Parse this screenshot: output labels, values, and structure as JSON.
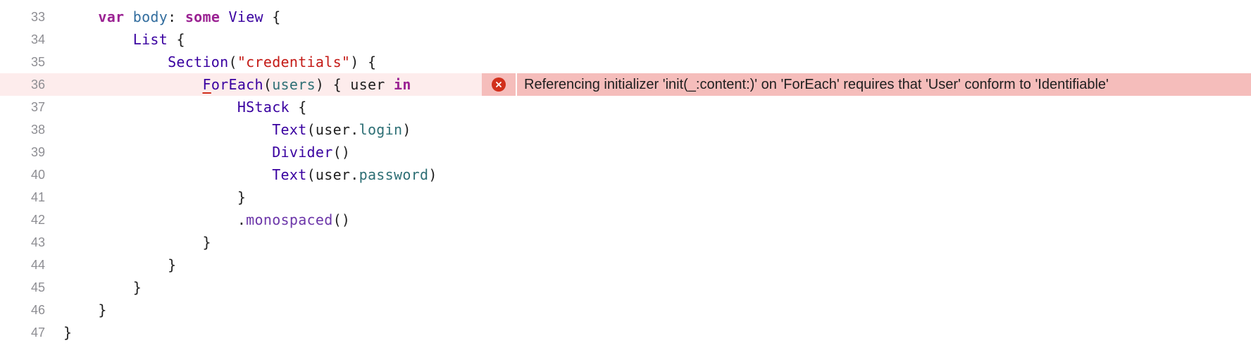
{
  "editor": {
    "lines": [
      {
        "number": "33",
        "tokens": [
          {
            "t": "    ",
            "c": "plain"
          },
          {
            "t": "var",
            "c": "kw"
          },
          {
            "t": " ",
            "c": "plain"
          },
          {
            "t": "body",
            "c": "ident-blue"
          },
          {
            "t": ": ",
            "c": "plain"
          },
          {
            "t": "some",
            "c": "kw"
          },
          {
            "t": " ",
            "c": "plain"
          },
          {
            "t": "View",
            "c": "ty"
          },
          {
            "t": " {",
            "c": "plain"
          }
        ]
      },
      {
        "number": "34",
        "tokens": [
          {
            "t": "        ",
            "c": "plain"
          },
          {
            "t": "List",
            "c": "ty"
          },
          {
            "t": " {",
            "c": "plain"
          }
        ]
      },
      {
        "number": "35",
        "tokens": [
          {
            "t": "            ",
            "c": "plain"
          },
          {
            "t": "Section",
            "c": "ty"
          },
          {
            "t": "(",
            "c": "plain"
          },
          {
            "t": "\"credentials\"",
            "c": "str"
          },
          {
            "t": ") {",
            "c": "plain"
          }
        ]
      },
      {
        "number": "36",
        "error": true,
        "tokens": [
          {
            "t": "                ",
            "c": "plain"
          },
          {
            "t": "F",
            "c": "ty err-under"
          },
          {
            "t": "orEach",
            "c": "ty"
          },
          {
            "t": "(",
            "c": "plain"
          },
          {
            "t": "users",
            "c": "var"
          },
          {
            "t": ") { user ",
            "c": "plain"
          },
          {
            "t": "in",
            "c": "kw"
          }
        ]
      },
      {
        "number": "37",
        "tokens": [
          {
            "t": "                    ",
            "c": "plain"
          },
          {
            "t": "HStack",
            "c": "ty"
          },
          {
            "t": " {",
            "c": "plain"
          }
        ]
      },
      {
        "number": "38",
        "tokens": [
          {
            "t": "                        ",
            "c": "plain"
          },
          {
            "t": "Text",
            "c": "ty"
          },
          {
            "t": "(user.",
            "c": "plain"
          },
          {
            "t": "login",
            "c": "prop"
          },
          {
            "t": ")",
            "c": "plain"
          }
        ]
      },
      {
        "number": "39",
        "tokens": [
          {
            "t": "                        ",
            "c": "plain"
          },
          {
            "t": "Divider",
            "c": "ty"
          },
          {
            "t": "()",
            "c": "plain"
          }
        ]
      },
      {
        "number": "40",
        "tokens": [
          {
            "t": "                        ",
            "c": "plain"
          },
          {
            "t": "Text",
            "c": "ty"
          },
          {
            "t": "(user.",
            "c": "plain"
          },
          {
            "t": "password",
            "c": "prop"
          },
          {
            "t": ")",
            "c": "plain"
          }
        ]
      },
      {
        "number": "41",
        "tokens": [
          {
            "t": "                    }",
            "c": "plain"
          }
        ]
      },
      {
        "number": "42",
        "tokens": [
          {
            "t": "                    .",
            "c": "plain"
          },
          {
            "t": "monospaced",
            "c": "mth"
          },
          {
            "t": "()",
            "c": "plain"
          }
        ]
      },
      {
        "number": "43",
        "tokens": [
          {
            "t": "                }",
            "c": "plain"
          }
        ]
      },
      {
        "number": "44",
        "tokens": [
          {
            "t": "            }",
            "c": "plain"
          }
        ]
      },
      {
        "number": "45",
        "tokens": [
          {
            "t": "        }",
            "c": "plain"
          }
        ]
      },
      {
        "number": "46",
        "tokens": [
          {
            "t": "    }",
            "c": "plain"
          }
        ]
      },
      {
        "number": "47",
        "tokens": [
          {
            "t": "}",
            "c": "plain"
          }
        ]
      }
    ]
  },
  "error": {
    "icon": "error-x-circle-icon",
    "message": "Referencing initializer 'init(_:content:)' on 'ForEach' requires that 'User' conform to 'Identifiable'"
  },
  "colors": {
    "error_line_bg": "#fdecec",
    "error_banner_bg": "#f5bdbb",
    "error_icon": "#d12f1b",
    "keyword": "#9b2393",
    "type": "#3900a0",
    "string": "#c41a16",
    "property": "#2d6f75"
  }
}
